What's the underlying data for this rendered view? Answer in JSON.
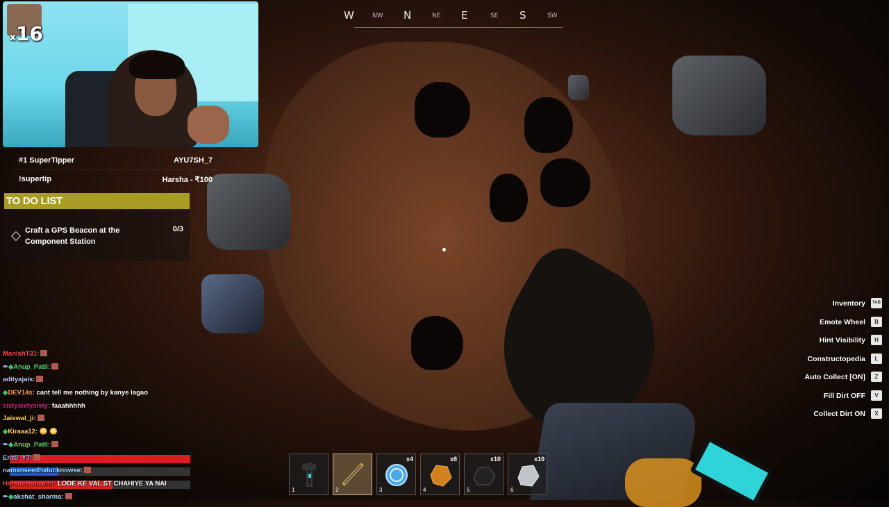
{
  "compass": {
    "main": [
      "W",
      "N",
      "E",
      "S"
    ],
    "sub": [
      "NW",
      "NE",
      "SE",
      "SW"
    ]
  },
  "webcam": {
    "multiplier_prefix": "x",
    "multiplier_value": "16"
  },
  "tipper": {
    "rows": [
      {
        "label": "#1 SuperTipper",
        "value": "AYU7SH_7"
      },
      {
        "label": "!supertip",
        "value": "Harsha - ₹100"
      }
    ]
  },
  "todo": {
    "title": "TO DO LIST",
    "task": "Craft a GPS Beacon at the Component Station",
    "progress": "0/3"
  },
  "hints": [
    {
      "label": "Inventory",
      "key": "TAB"
    },
    {
      "label": "Emote Wheel",
      "key": "B"
    },
    {
      "label": "Hint Visibility",
      "key": "H"
    },
    {
      "label": "Constructopedia",
      "key": "L"
    },
    {
      "label": "Auto Collect [ON]",
      "key": "Z"
    },
    {
      "label": "Fill Dirt OFF",
      "key": "V"
    },
    {
      "label": "Collect Dirt ON",
      "key": "X"
    }
  ],
  "chat": [
    {
      "user": "ManishT31:",
      "msg": "",
      "color": "#ff4a4a"
    },
    {
      "user": "Anup_Patil:",
      "msg": "",
      "color": "#5fd36b"
    },
    {
      "user": "adityajais:",
      "msg": "",
      "color": "#c9c9ff"
    },
    {
      "user": "DEV14s:",
      "msg": "cant tell me nothing by kanye lagao",
      "color": "#ff9a3c"
    },
    {
      "user": "sixtysixtysixty:",
      "msg": "faaahhhhh",
      "color": "#b0307a"
    },
    {
      "user": "Jaiswal_ji:",
      "msg": "",
      "color": "#ffd35a"
    },
    {
      "user": "Kiraaa12:",
      "msg": "😳 😳",
      "color": "#ffd35a"
    },
    {
      "user": "Anup_Patil:",
      "msg": "",
      "color": "#5fd36b"
    },
    {
      "user": "Enz0_YT:",
      "msg": "",
      "color": "#9ab0ff"
    },
    {
      "user": "namanseedhalucknowse:",
      "msg": "",
      "color": "#9fdfff"
    },
    {
      "user": "Harshashaaantil:",
      "msg": "LODE KE VAL ST CHAHIYE YA NAI",
      "color": "#ff4a4a"
    },
    {
      "user": "akshat_sharma:",
      "msg": "",
      "color": "#9fdfff"
    }
  ],
  "hotbar": [
    {
      "num": "1",
      "count": "",
      "icon": "pickaxe-icon",
      "color": "#2a2a2a",
      "selected": false
    },
    {
      "num": "2",
      "count": "",
      "icon": "drill-tool-icon",
      "color": "#c9a040",
      "selected": true
    },
    {
      "num": "3",
      "count": "x4",
      "icon": "blue-token-icon",
      "color": "#4aa8e8",
      "selected": false
    },
    {
      "num": "4",
      "count": "x8",
      "icon": "copper-ore-icon",
      "color": "#d0801e",
      "selected": false
    },
    {
      "num": "5",
      "count": "x10",
      "icon": "coal-icon",
      "color": "#222",
      "selected": false
    },
    {
      "num": "6",
      "count": "x10",
      "icon": "stone-icon",
      "color": "#bfc4c8",
      "selected": false
    }
  ]
}
